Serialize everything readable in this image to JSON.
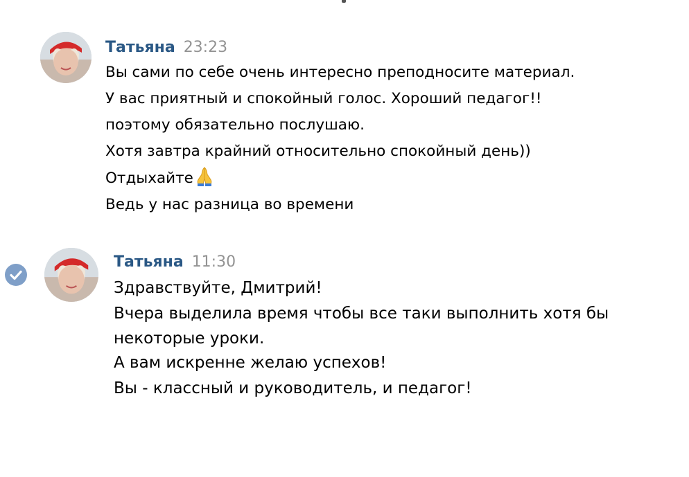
{
  "messages": [
    {
      "author": "Татьяна",
      "time": "23:23",
      "lines": [
        "Вы сами по себе очень интересно преподносите материал.",
        "У вас приятный и спокойный голос. Хороший педагог!!",
        "поэтому обязательно послушаю.",
        "Хотя завтра крайний относительно спокойный день))",
        "Отдыхайте",
        "Ведь у нас разница во времени"
      ],
      "emoji_icon": "praying-hands-icon"
    },
    {
      "author": "Татьяна",
      "time": "11:30",
      "selected": true,
      "lines": [
        "Здравствуйте, Дмитрий!",
        "Вчера выделила время чтобы все таки выполнить хотя бы",
        "некоторые уроки.",
        "А вам искренне желаю успехов!",
        "Вы - классный и руководитель, и педагог!"
      ]
    }
  ],
  "colors": {
    "author": "#2a5885",
    "time": "#939393",
    "check": "#7f9fc8"
  }
}
